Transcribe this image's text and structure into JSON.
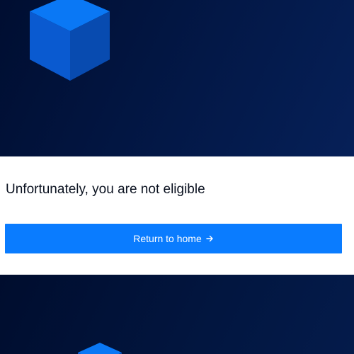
{
  "notice": {
    "message": "Unfortunately, you are not eligible",
    "button_label": "Return to home",
    "button_icon": "arrow-right-icon"
  },
  "decor": {
    "top_shape": "cube-icon",
    "bottom_shape": "cube-icon"
  },
  "colors": {
    "background_dark": "#000f35",
    "panel": "#ffffff",
    "accent": "#0a7cff",
    "cube_face_top": "#0a78f5",
    "cube_face_side": "#0a56c8"
  }
}
